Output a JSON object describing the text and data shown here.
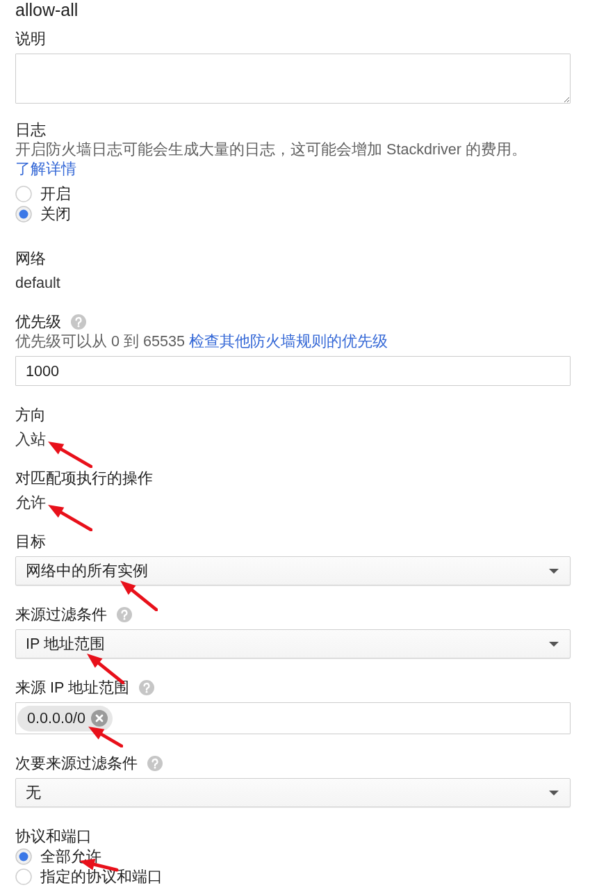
{
  "title": "allow-all",
  "fields": [
    {
      "kind": "textarea",
      "label": "说明",
      "help_icon": false,
      "annotated": false
    },
    {
      "kind": "radio",
      "label": "日志",
      "help_icon": false,
      "annotated": false,
      "help_text": "开启防火墙日志可能会生成大量的日志，这可能会增加 Stackdriver 的费用。",
      "link": "了解详情",
      "options": [
        {
          "label": "开启",
          "selected": false,
          "annotated": false
        },
        {
          "label": "关闭",
          "selected": true,
          "annotated": false
        }
      ]
    },
    {
      "kind": "static",
      "label": "网络",
      "help_icon": false,
      "annotated": false,
      "value": "default"
    },
    {
      "kind": "input",
      "label": "优先级",
      "help_icon": true,
      "annotated": false,
      "help_text": "优先级可以从 0 到 65535",
      "link": "检查其他防火墙规则的优先级",
      "value": "1000"
    },
    {
      "kind": "static",
      "label": "方向",
      "help_icon": false,
      "annotated": true,
      "value": "入站"
    },
    {
      "kind": "static",
      "label": "对匹配项执行的操作",
      "help_icon": false,
      "annotated": true,
      "value": "允许"
    },
    {
      "kind": "select",
      "label": "目标",
      "help_icon": false,
      "annotated": true,
      "value": "网络中的所有实例"
    },
    {
      "kind": "select",
      "label": "来源过滤条件",
      "help_icon": true,
      "annotated": true,
      "value": "IP 地址范围"
    },
    {
      "kind": "chips",
      "label": "来源 IP 地址范围",
      "help_icon": true,
      "annotated": true,
      "chips": [
        {
          "label": "0.0.0.0/0"
        }
      ]
    },
    {
      "kind": "select",
      "label": "次要来源过滤条件",
      "help_icon": true,
      "annotated": false,
      "value": "无"
    },
    {
      "kind": "radio",
      "label": "协议和端口",
      "help_icon": false,
      "annotated": false,
      "options": [
        {
          "label": "全部允许",
          "selected": true,
          "annotated": true
        },
        {
          "label": "指定的协议和端口",
          "selected": false,
          "annotated": false
        }
      ]
    }
  ]
}
